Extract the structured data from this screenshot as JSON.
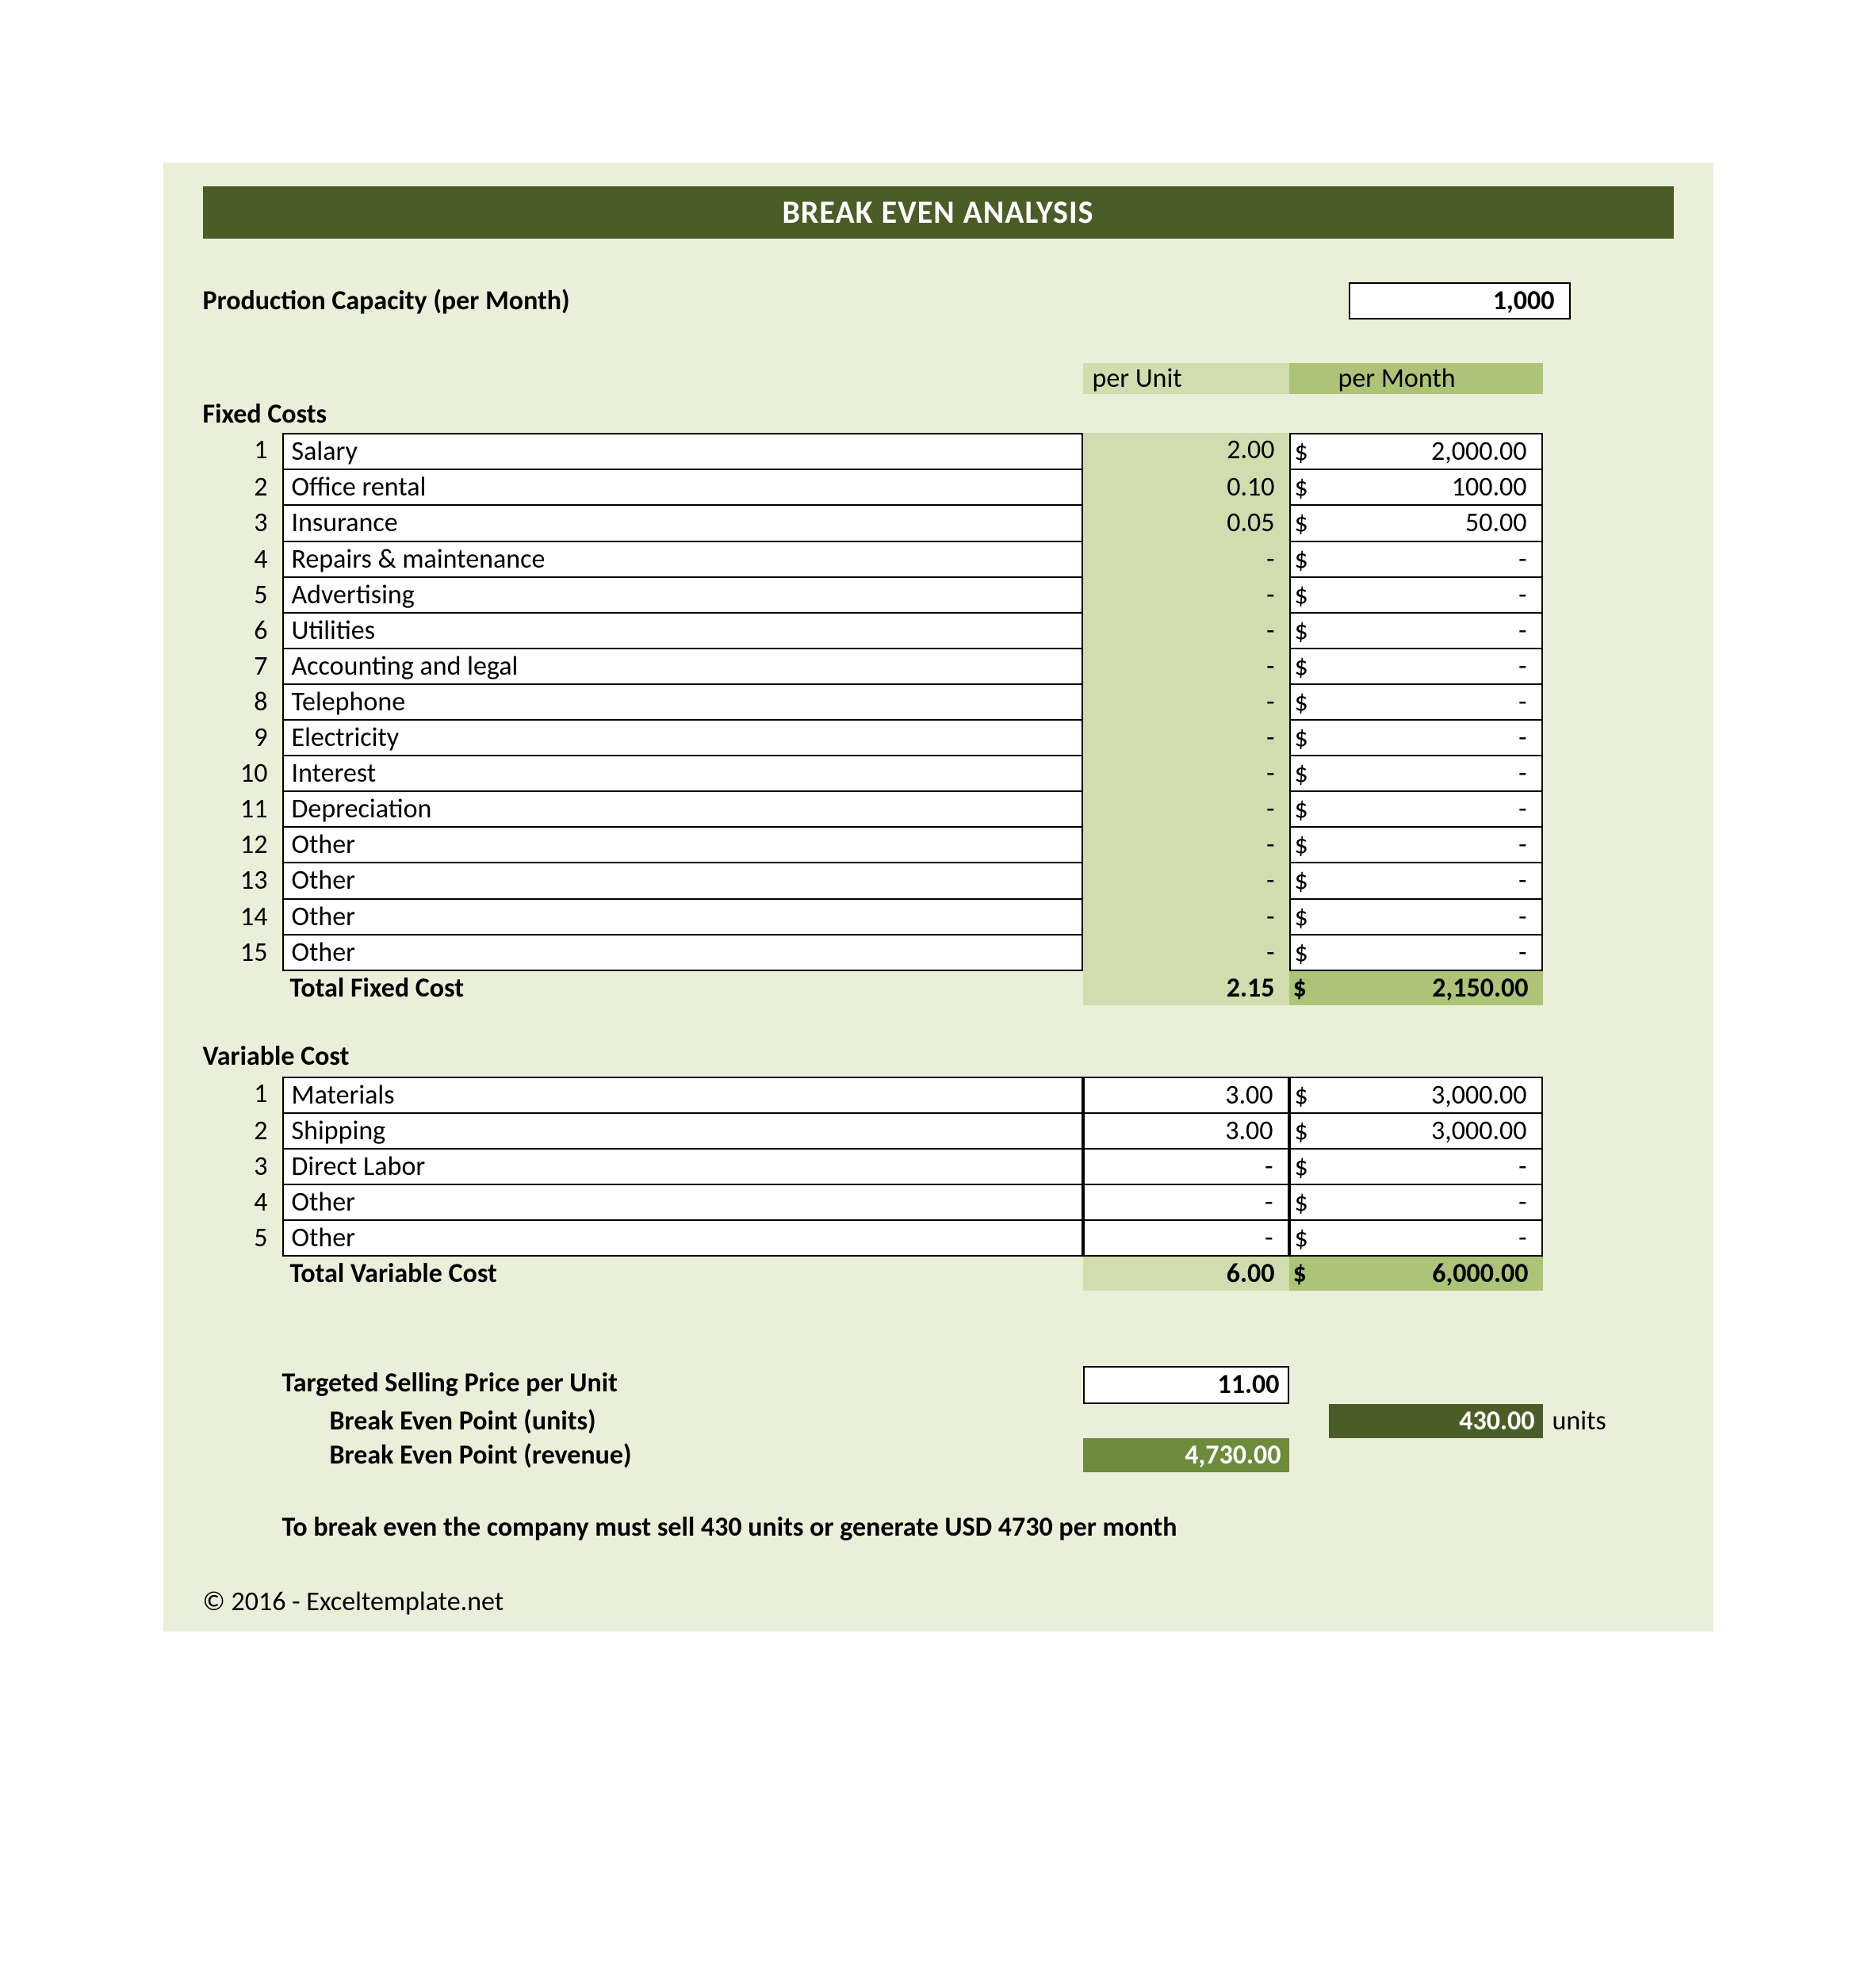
{
  "title": "BREAK EVEN ANALYSIS",
  "production": {
    "label": "Production Capacity (per Month)",
    "value": "1,000"
  },
  "col_headers": {
    "per_unit": "per Unit",
    "per_month": "per Month"
  },
  "fixed": {
    "heading": "Fixed Costs",
    "rows": [
      {
        "n": "1",
        "label": "Salary",
        "unit": "2.00",
        "cur": "$",
        "month": "2,000.00"
      },
      {
        "n": "2",
        "label": "Office rental",
        "unit": "0.10",
        "cur": "$",
        "month": "100.00"
      },
      {
        "n": "3",
        "label": "Insurance",
        "unit": "0.05",
        "cur": "$",
        "month": "50.00"
      },
      {
        "n": "4",
        "label": "Repairs & maintenance",
        "unit": "-",
        "cur": "$",
        "month": "-"
      },
      {
        "n": "5",
        "label": "Advertising",
        "unit": "-",
        "cur": "$",
        "month": "-"
      },
      {
        "n": "6",
        "label": "Utilities",
        "unit": "-",
        "cur": "$",
        "month": "-"
      },
      {
        "n": "7",
        "label": "Accounting and legal",
        "unit": "-",
        "cur": "$",
        "month": "-"
      },
      {
        "n": "8",
        "label": "Telephone",
        "unit": "-",
        "cur": "$",
        "month": "-"
      },
      {
        "n": "9",
        "label": "Electricity",
        "unit": "-",
        "cur": "$",
        "month": "-"
      },
      {
        "n": "10",
        "label": "Interest",
        "unit": "-",
        "cur": "$",
        "month": "-"
      },
      {
        "n": "11",
        "label": "Depreciation",
        "unit": "-",
        "cur": "$",
        "month": "-"
      },
      {
        "n": "12",
        "label": "Other",
        "unit": "-",
        "cur": "$",
        "month": "-"
      },
      {
        "n": "13",
        "label": "Other",
        "unit": "-",
        "cur": "$",
        "month": "-"
      },
      {
        "n": "14",
        "label": "Other",
        "unit": "-",
        "cur": "$",
        "month": "-"
      },
      {
        "n": "15",
        "label": "Other",
        "unit": "-",
        "cur": "$",
        "month": "-"
      }
    ],
    "total": {
      "label": "Total Fixed Cost",
      "unit": "2.15",
      "cur": "$",
      "month": "2,150.00"
    }
  },
  "variable": {
    "heading": "Variable Cost",
    "rows": [
      {
        "n": "1",
        "label": "Materials",
        "unit": "3.00",
        "cur": "$",
        "month": "3,000.00"
      },
      {
        "n": "2",
        "label": "Shipping",
        "unit": "3.00",
        "cur": "$",
        "month": "3,000.00"
      },
      {
        "n": "3",
        "label": "Direct Labor",
        "unit": "-",
        "cur": "$",
        "month": "-"
      },
      {
        "n": "4",
        "label": "Other",
        "unit": "-",
        "cur": "$",
        "month": "-"
      },
      {
        "n": "5",
        "label": "Other",
        "unit": "-",
        "cur": "$",
        "month": "-"
      }
    ],
    "total": {
      "label": "Total Variable Cost",
      "unit": "6.00",
      "cur": "$",
      "month": "6,000.00"
    }
  },
  "selling": {
    "label": "Targeted Selling Price per Unit",
    "value": "11.00"
  },
  "be_units": {
    "label": "Break Even Point (units)",
    "value": "430.00",
    "suffix": "units"
  },
  "be_revenue": {
    "label": "Break Even Point (revenue)",
    "value": "4,730.00"
  },
  "summary": "To break even the company must sell 430 units or generate USD 4730 per month",
  "copyright": "© 2016 - Exceltemplate.net"
}
